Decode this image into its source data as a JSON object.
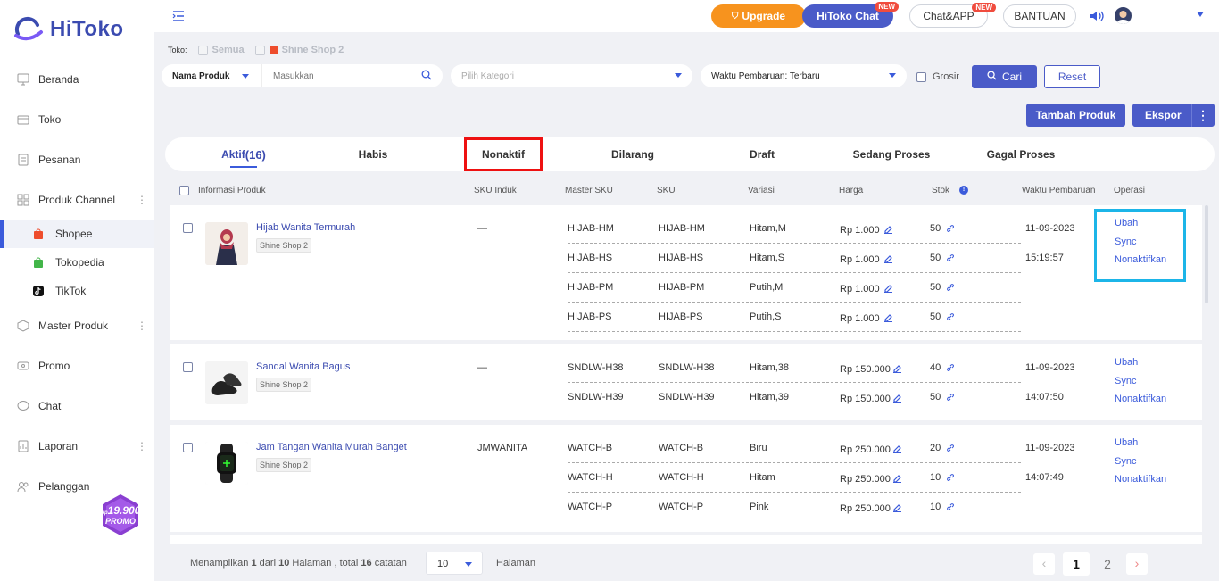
{
  "brand": {
    "name": "HiToko",
    "accent": "#3b4bb0"
  },
  "sidebar": {
    "items": [
      {
        "label": "Beranda",
        "icon": "monitor-icon"
      },
      {
        "label": "Toko",
        "icon": "store-icon"
      },
      {
        "label": "Pesanan",
        "icon": "clipboard-icon"
      },
      {
        "label": "Produk Channel",
        "icon": "grid-icon"
      },
      {
        "label": "Master Produk",
        "icon": "cube-icon"
      },
      {
        "label": "Promo",
        "icon": "megaphone-icon"
      },
      {
        "label": "Chat",
        "icon": "chat-icon"
      },
      {
        "label": "Laporan",
        "icon": "report-icon"
      },
      {
        "label": "Pelanggan",
        "icon": "users-icon"
      }
    ],
    "channels": [
      {
        "label": "Shopee",
        "icon": "shopee-icon"
      },
      {
        "label": "Tokopedia",
        "icon": "tokopedia-icon"
      },
      {
        "label": "TikTok",
        "icon": "tiktok-icon"
      }
    ],
    "promo": {
      "price": "19.900",
      "rp": "Rp",
      "label": "PROMO"
    }
  },
  "topbar": {
    "upgrade": "Upgrade",
    "hitoko_chat": "HiToko Chat",
    "chat_app": "Chat&APP",
    "bantuan": "BANTUAN",
    "new_badge": "NEW"
  },
  "filters": {
    "toko_label": "Toko:",
    "semua": "Semua",
    "shop": "Shine Shop 2",
    "field_select": "Nama Produk",
    "search_placeholder": "Masukkan",
    "kategori_placeholder": "Pilih Kategori",
    "waktu": "Waktu Pembaruan: Terbaru",
    "grosir": "Grosir",
    "cari": "Cari",
    "reset": "Reset",
    "tambah": "Tambah Produk",
    "ekspor": "Ekspor"
  },
  "tabs": [
    {
      "label": "Aktif",
      "count": "(16)"
    },
    {
      "label": "Habis"
    },
    {
      "label": "Nonaktif"
    },
    {
      "label": "Dilarang"
    },
    {
      "label": "Draft"
    },
    {
      "label": "Sedang Proses"
    },
    {
      "label": "Gagal Proses"
    }
  ],
  "columns": [
    "Informasi Produk",
    "SKU Induk",
    "Master SKU",
    "SKU",
    "Variasi",
    "Harga",
    "Stok",
    "Waktu Pembaruan",
    "Operasi"
  ],
  "products": [
    {
      "name": "Hijab Wanita Termurah",
      "shop": "Shine Shop 2",
      "sku_induk": "—",
      "date": "11-09-2023",
      "time": "15:19:57",
      "variants": [
        {
          "master": "HIJAB-HM",
          "sku": "HIJAB-HM",
          "var": "Hitam,M",
          "price": "Rp 1.000",
          "stock": "50"
        },
        {
          "master": "HIJAB-HS",
          "sku": "HIJAB-HS",
          "var": "Hitam,S",
          "price": "Rp 1.000",
          "stock": "50"
        },
        {
          "master": "HIJAB-PM",
          "sku": "HIJAB-PM",
          "var": "Putih,M",
          "price": "Rp 1.000",
          "stock": "50"
        },
        {
          "master": "HIJAB-PS",
          "sku": "HIJAB-PS",
          "var": "Putih,S",
          "price": "Rp 1.000",
          "stock": "50"
        }
      ]
    },
    {
      "name": "Sandal Wanita Bagus",
      "shop": "Shine Shop 2",
      "sku_induk": "—",
      "date": "11-09-2023",
      "time": "14:07:50",
      "variants": [
        {
          "master": "SNDLW-H38",
          "sku": "SNDLW-H38",
          "var": "Hitam,38",
          "price": "Rp 150.000",
          "stock": "40"
        },
        {
          "master": "SNDLW-H39",
          "sku": "SNDLW-H39",
          "var": "Hitam,39",
          "price": "Rp 150.000",
          "stock": "50"
        }
      ]
    },
    {
      "name": "Jam Tangan Wanita Murah Banget",
      "shop": "Shine Shop 2",
      "sku_induk": "JMWANITA",
      "date": "11-09-2023",
      "time": "14:07:49",
      "variants": [
        {
          "master": "WATCH-B",
          "sku": "WATCH-B",
          "var": "Biru",
          "price": "Rp 250.000",
          "stock": "20"
        },
        {
          "master": "WATCH-H",
          "sku": "WATCH-H",
          "var": "Hitam",
          "price": "Rp 250.000",
          "stock": "10"
        },
        {
          "master": "WATCH-P",
          "sku": "WATCH-P",
          "var": "Pink",
          "price": "Rp 250.000",
          "stock": "10"
        }
      ]
    }
  ],
  "ops": {
    "ubah": "Ubah",
    "sync": "Sync",
    "nonaktifkan": "Nonaktifkan"
  },
  "pager": {
    "p1": "Menampilkan ",
    "cur": "1",
    "p2": " dari ",
    "total_pages": "10",
    "p3": " Halaman , total ",
    "total": "16",
    "p4": " catatan",
    "per_page": "10",
    "halaman": "Halaman",
    "pages": [
      "1",
      "2"
    ]
  }
}
